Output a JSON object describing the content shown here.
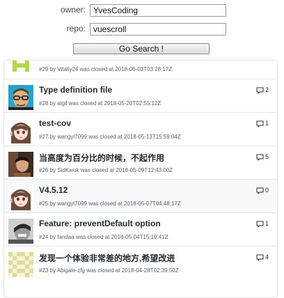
{
  "form": {
    "owner_label": "owner:",
    "owner_value": "YvesCoding",
    "repo_label": "repo:",
    "repo_value": "vuescroll",
    "go_label": "Go Search !"
  },
  "issues": [
    {
      "number": "#29",
      "user": "Vitaliy24",
      "closed_at": "2018-06-03T03:28:17Z",
      "title": "",
      "comments": "",
      "avatar": "identicon-green"
    },
    {
      "number": "#28",
      "user": "algil",
      "closed_at": "2018-05-20T02:55:12Z",
      "title": "Type definition file",
      "comments": "2",
      "avatar": "photo-glasses"
    },
    {
      "number": "#27",
      "user": "wangyi7099",
      "closed_at": "2018-05-13T15:59:04Z",
      "title": "test-cov",
      "comments": "1",
      "avatar": "anime-girl"
    },
    {
      "number": "#26",
      "user": "SidKwok",
      "closed_at": "2018-05-09T12:43:00Z",
      "title": "当高度为百分比的时候，不起作用",
      "comments": "5",
      "avatar": "photo-portrait"
    },
    {
      "number": "#25",
      "user": "wangyi7099",
      "closed_at": "2018-05-07T04:48:17Z",
      "title": "V4.5.12",
      "comments": "0",
      "avatar": "anime-girl"
    },
    {
      "number": "#24",
      "user": "fandaa",
      "closed_at": "2018-05-04T15:19:41Z",
      "title": "Feature: preventDefault option",
      "comments": "1",
      "avatar": "photo-bw"
    },
    {
      "number": "#23",
      "user": "Abigale-zfg",
      "closed_at": "2018-04-28T02:39:50Z",
      "title": "发现一个体验非常差的地方,希望改进",
      "comments": "4",
      "avatar": "identicon-yellow"
    }
  ],
  "meta_joiner": "was closed at",
  "colors": {
    "border": "#e1e4e8",
    "shaded_row": "#f6f8fa",
    "identicon_green": "#b4d84a",
    "identicon_yellow": "#e8e4a8"
  }
}
